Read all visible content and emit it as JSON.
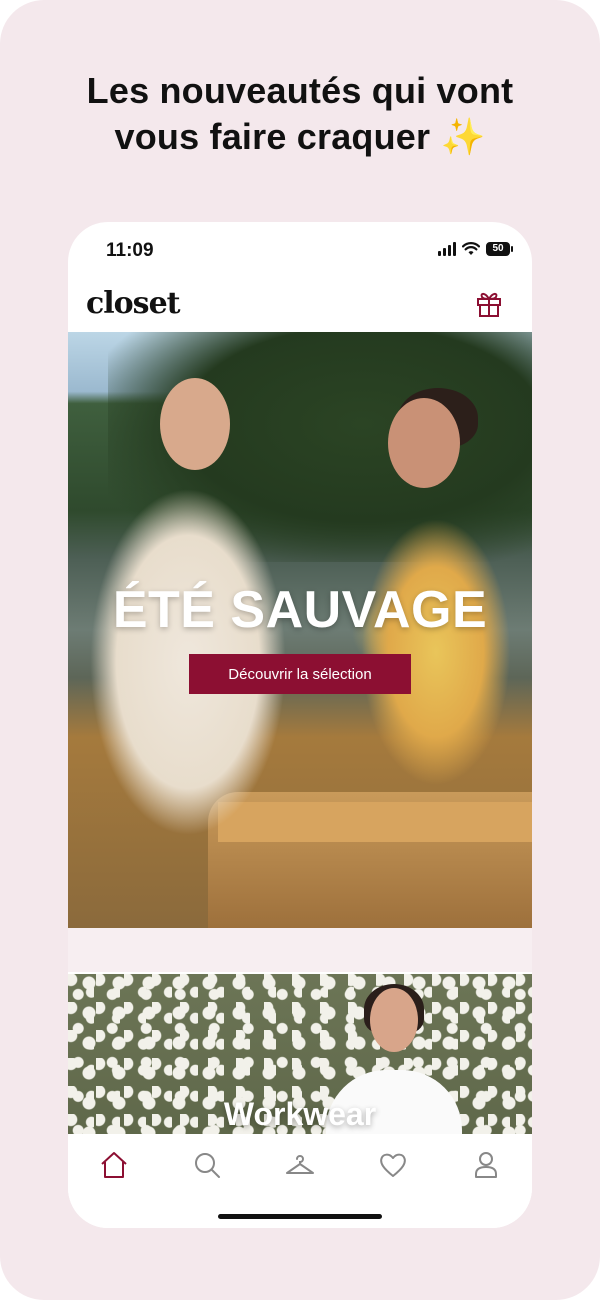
{
  "promo": {
    "headline_line1": "Les nouveautés qui vont",
    "headline_line2": "vous faire craquer",
    "sparkle": "✨"
  },
  "status_bar": {
    "time": "11:09",
    "battery": "50"
  },
  "app": {
    "logo": "closet",
    "brand_color": "#8c0f32"
  },
  "hero": {
    "title": "ÉTÉ SAUVAGE",
    "cta_label": "Découvrir la sélection"
  },
  "second_banner": {
    "title": "Workwear"
  },
  "tab_bar": {
    "items": [
      {
        "icon": "home-icon",
        "active": true
      },
      {
        "icon": "search-icon",
        "active": false
      },
      {
        "icon": "hanger-icon",
        "active": false
      },
      {
        "icon": "heart-icon",
        "active": false
      },
      {
        "icon": "profile-icon",
        "active": false
      }
    ]
  }
}
